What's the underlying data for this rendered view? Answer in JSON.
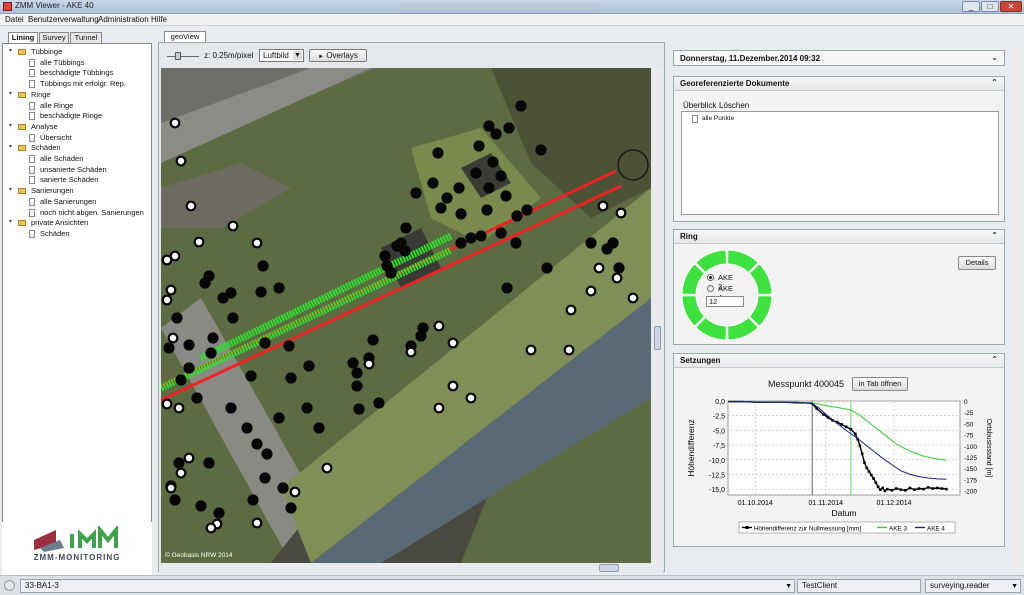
{
  "window": {
    "title": "ZMM Viewer - AKE 40",
    "minimize": "_",
    "maximize": "□",
    "close": "✕"
  },
  "menu": [
    "Datei",
    "Benutzerverwaltung",
    "Administration",
    "Hilfe"
  ],
  "left_tabs": [
    "Lining",
    "Survey",
    "Tunnel"
  ],
  "tree": [
    {
      "label": "Tübbinge",
      "children": [
        "alle Tübbings",
        "beschädigte Tübbings",
        "Tübbings mit erfolgr. Rep."
      ]
    },
    {
      "label": "Ringe",
      "children": [
        "alle Ringe",
        "beschädigte Ringe"
      ]
    },
    {
      "label": "Analyse",
      "children": [
        "Übersicht"
      ]
    },
    {
      "label": "Schäden",
      "children": [
        "alle Schäden",
        "unsanierte Schäden",
        "sanierte Schäden"
      ]
    },
    {
      "label": "Sanierungen",
      "children": [
        "alle Sanierungen",
        "noch nicht abgen. Sanierungen"
      ]
    },
    {
      "label": "private Ansichten",
      "children": [
        "Schäden"
      ]
    }
  ],
  "logo": {
    "text": "ZMM-MONITORING",
    "brand_colors": [
      "#9a3040",
      "#6b7d8c",
      "#3fa34d"
    ]
  },
  "geoview": {
    "tab_label": "geoView",
    "scale_label": "z: 0.25m/pixel",
    "layer": "Luftbild",
    "overlays_button": "Overlays",
    "credit": "© Geobasis NRW 2014"
  },
  "right": {
    "date": "Donnerstag, 11.Dezember.2014 09:32",
    "docs": {
      "title": "Georeferenzierte Dokumente",
      "actions": [
        "Überblick",
        "Löschen"
      ],
      "items": [
        "alle Punkte"
      ]
    },
    "ring": {
      "title": "Ring",
      "options": [
        "AKE 3",
        "AKE 4"
      ],
      "selected": "AKE 3",
      "value": "12",
      "details_button": "Details",
      "segment_color": "#3ee23e"
    },
    "settlements": {
      "title": "Setzungen",
      "point_label": "Messpunkt 400045",
      "open_tab_button": "in Tab öffnen"
    }
  },
  "chart_data": {
    "type": "line",
    "x_ticks": [
      "01.10.2014",
      "01.11.2014",
      "01.12.2014"
    ],
    "xlabel": "Datum",
    "ylabel": "Höhendifferenz",
    "y2label": "Ortsbustsstand [m]",
    "ylim": [
      -16,
      0
    ],
    "y_ticks": [
      "0,0",
      "-2,5",
      "-5,0",
      "-7,5",
      "-10,0",
      "-12,5",
      "-15,0"
    ],
    "y2lim": [
      -210,
      0
    ],
    "y2_ticks": [
      "0",
      "-25",
      "-50",
      "-75",
      "-100",
      "-125",
      "-150",
      "-175",
      "-200"
    ],
    "grid": true,
    "markers": {
      "vline_dark_day": 37,
      "vline_green_day": 54
    },
    "series": [
      {
        "name": "Höhendifferenz zur Nullmessung [mm]",
        "axis": "left",
        "color": "#000000",
        "marker": "square",
        "days": [
          0,
          6,
          12,
          18,
          24,
          30,
          34,
          36,
          37,
          39,
          42,
          44,
          46,
          48,
          50,
          52,
          54,
          56,
          57,
          58,
          59,
          60,
          61,
          62,
          63,
          64,
          65,
          66,
          67,
          68,
          69,
          70,
          72,
          74,
          76,
          78,
          80,
          82,
          84,
          86,
          88,
          90,
          92,
          94,
          96
        ],
        "values": [
          -0.1,
          -0.1,
          -0.2,
          -0.2,
          -0.2,
          -0.3,
          -0.3,
          -0.4,
          -0.5,
          -1.3,
          -2.3,
          -2.8,
          -3.3,
          -3.6,
          -4.0,
          -4.4,
          -4.8,
          -5.6,
          -6.5,
          -7.6,
          -9.0,
          -10.5,
          -11.4,
          -12.0,
          -12.6,
          -13.2,
          -13.9,
          -14.6,
          -15.1,
          -14.8,
          -15.3,
          -15.0,
          -15.2,
          -14.9,
          -15.1,
          -15.2,
          -14.8,
          -15.1,
          -14.9,
          -15.0,
          -14.7,
          -14.9,
          -14.8,
          -14.9,
          -15.0
        ]
      },
      {
        "name": "AKE 3",
        "axis": "right",
        "color": "#2ecc2e",
        "days": [
          0,
          10,
          20,
          30,
          37,
          40,
          45,
          50,
          54,
          58,
          62,
          66,
          70,
          74,
          78,
          82,
          86,
          90,
          94,
          96
        ],
        "values": [
          -2,
          -2,
          -3,
          -3,
          -4,
          -7,
          -12,
          -16,
          -20,
          -32,
          -48,
          -64,
          -80,
          -96,
          -107,
          -116,
          -123,
          -128,
          -131,
          -132
        ]
      },
      {
        "name": "AKE 4",
        "axis": "right",
        "color": "#1c1c8c",
        "days": [
          0,
          10,
          20,
          30,
          37,
          40,
          44,
          48,
          52,
          56,
          60,
          64,
          68,
          72,
          76,
          80,
          84,
          88,
          92,
          96
        ],
        "values": [
          -2,
          -2,
          -3,
          -3,
          -5,
          -16,
          -34,
          -50,
          -66,
          -80,
          -96,
          -112,
          -128,
          -142,
          -156,
          -164,
          -169,
          -172,
          -174,
          -175
        ]
      }
    ]
  },
  "status": {
    "left_field": "33-BA1-3",
    "client": "TestClient",
    "user": "surveying.reader"
  }
}
